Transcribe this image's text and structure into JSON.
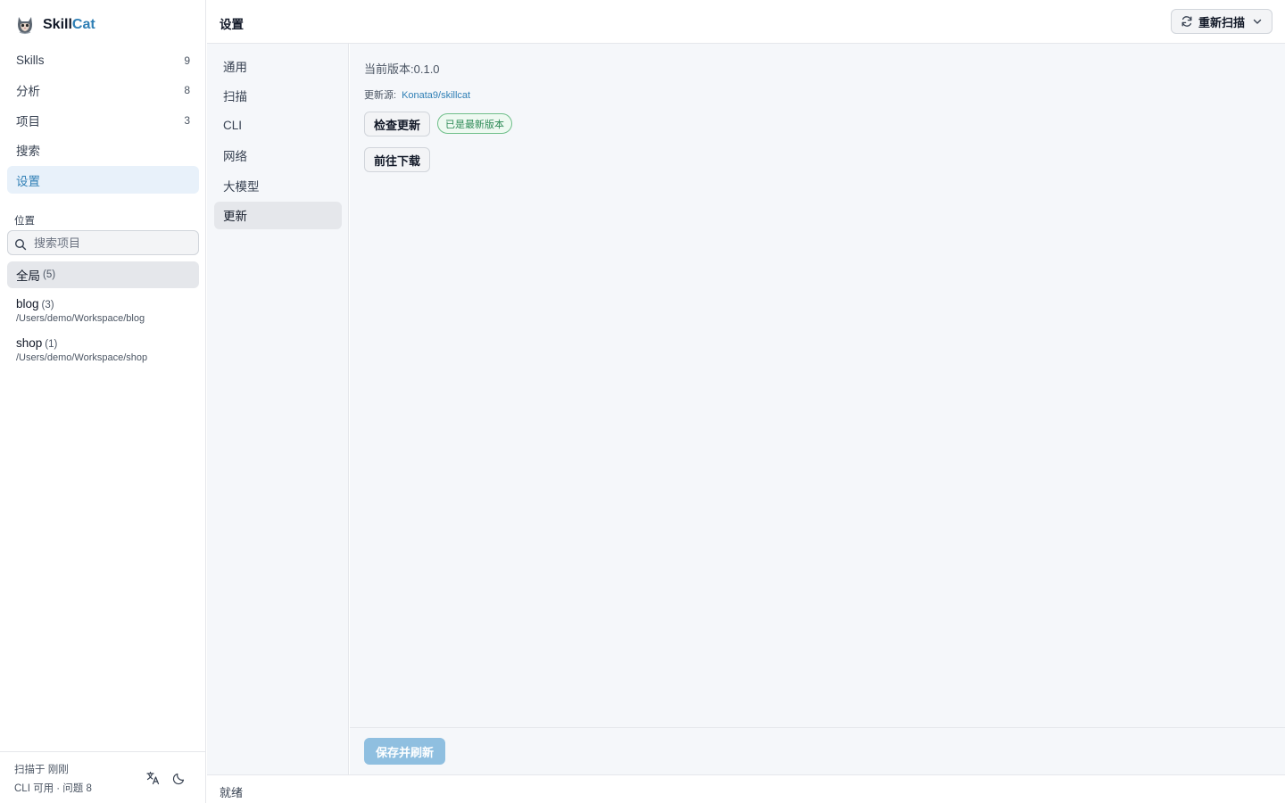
{
  "app": {
    "name_part1": "Skill",
    "name_part2": "Cat"
  },
  "nav": [
    {
      "label": "Skills",
      "count": "9"
    },
    {
      "label": "分析",
      "count": "8"
    },
    {
      "label": "项目",
      "count": "3"
    },
    {
      "label": "搜索",
      "count": ""
    },
    {
      "label": "设置",
      "count": ""
    }
  ],
  "locations_section": {
    "title": "位置",
    "search_placeholder": "搜索项目",
    "global": {
      "name": "全局",
      "count": "(5)"
    },
    "projects": [
      {
        "name": "blog",
        "count": "(3)",
        "path": "/Users/demo/Workspace/blog"
      },
      {
        "name": "shop",
        "count": "(1)",
        "path": "/Users/demo/Workspace/shop"
      }
    ]
  },
  "footer": {
    "scan_time": "扫描于 刚刚",
    "status": "CLI 可用 · 问题 8"
  },
  "header": {
    "title": "设置",
    "rescan_label": "重新扫描"
  },
  "settings_nav": [
    "通用",
    "扫描",
    "CLI",
    "网络",
    "大模型",
    "更新"
  ],
  "update": {
    "version_label": "当前版本:",
    "version": "0.1.0",
    "source_label": "更新源:",
    "source_link": "Konata9/skillcat",
    "check_button": "检查更新",
    "latest_badge": "已是最新版本",
    "download_button": "前往下载"
  },
  "save_button": "保存并刷新",
  "status_bar": "就绪",
  "colors": {
    "accent": "#2f7fb5",
    "active_bg": "#e8f1fa",
    "badge_green": "#2e8b57",
    "save_button": "#8fbfe0"
  }
}
